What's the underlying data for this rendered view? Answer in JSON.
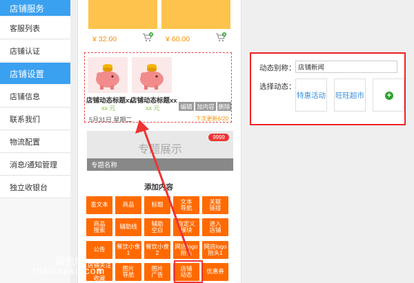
{
  "sidebar": {
    "section1": "店铺服务",
    "items1": [
      "客服列表",
      "店铺认证"
    ],
    "section2": "店铺设置",
    "items2": [
      "店铺信息",
      "联系我们",
      "物流配置",
      "消息/通知管理",
      "独立收银台"
    ]
  },
  "products": [
    {
      "price": "¥ 32.00"
    },
    {
      "price": "¥ 60.00"
    }
  ],
  "dynamic": {
    "cards": [
      {
        "title": "店铺动态标题xx",
        "unit": "xx 元"
      },
      {
        "title": "店铺动态标题xx",
        "unit": "xx 元"
      }
    ],
    "actions": [
      "编辑",
      "加内容",
      "删除"
    ],
    "date": "5月31日 星期二",
    "more": "下次更新6/20"
  },
  "topic": {
    "title": "专题展示",
    "label": "专题名称",
    "badge": "9999"
  },
  "add": {
    "title": "添加内容",
    "buttons": [
      [
        "富文本",
        "商品",
        "标题",
        "文本\n导航",
        "关联\n链接"
      ],
      [
        "商品\n搜索",
        "辅助线",
        "辅助\n空白",
        "自定义\n模块",
        "进入\n店铺"
      ],
      [
        "公告",
        "餐饮小食1",
        "餐饮小食2",
        "网店logo\n抬头",
        "网店logo\n抬头1"
      ],
      [
        "店铺关注和\n收藏",
        "图片\n导航",
        "图片\n广告",
        "店铺\n动态",
        "优惠券"
      ]
    ]
  },
  "panel": {
    "alias_label": "动态别称：",
    "alias_value": "店铺新闻",
    "select_label": "选择动态：",
    "tags": [
      "特惠活动",
      "旺旺超市"
    ]
  },
  "watermark": {
    "cn": "展览库",
    "en": "zhanlanku.com"
  },
  "colors": {
    "accent": "#3aa0f0",
    "orange": "#ff6a00",
    "highlight": "#e22"
  }
}
